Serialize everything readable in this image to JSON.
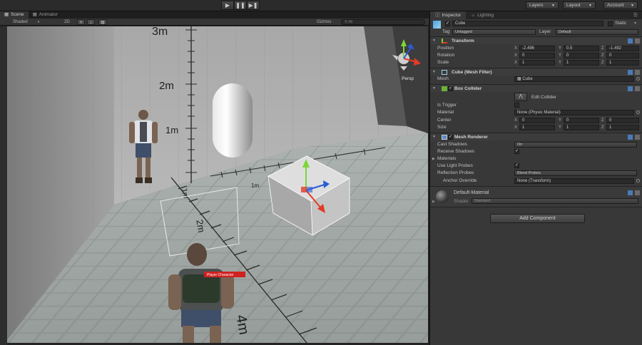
{
  "toolbar": {
    "play_icon": "play-icon",
    "pause_icon": "pause-icon",
    "step_icon": "step-icon",
    "layers_label": "Layers",
    "layout_label": "Layout",
    "account_label": "Account"
  },
  "scene": {
    "tabs": [
      {
        "label": "Scene"
      },
      {
        "label": "Animator"
      }
    ],
    "shading_mode": "Shaded",
    "mode_2d": "2D",
    "gizmos_label": "Gizmos",
    "search_placeholder": "All",
    "persp_label": "Persp",
    "ruler_labels": [
      "3m",
      "2m",
      "1m",
      "1m",
      "2m",
      "4m"
    ],
    "name_tag": "Player Character"
  },
  "inspector": {
    "tabs": [
      {
        "label": "Inspector"
      },
      {
        "label": "Lighting"
      }
    ],
    "object_name": "Cube",
    "static_label": "Static",
    "tag_label": "Tag",
    "tag_value": "Untagged",
    "layer_label": "Layer",
    "layer_value": "Default",
    "transform": {
      "title": "Transform",
      "position_label": "Position",
      "rotation_label": "Rotation",
      "scale_label": "Scale",
      "position": {
        "x": "-2.496",
        "y": "0.5",
        "z": "-1.492"
      },
      "rotation": {
        "x": "0",
        "y": "0",
        "z": "0"
      },
      "scale": {
        "x": "1",
        "y": "1",
        "z": "1"
      }
    },
    "mesh_filter": {
      "title": "Cube (Mesh Filter)",
      "mesh_label": "Mesh",
      "mesh_value": "Cube"
    },
    "box_collider": {
      "title": "Box Collider",
      "edit_collider_label": "Edit Collider",
      "is_trigger_label": "Is Trigger",
      "material_label": "Material",
      "material_value": "None (Physic Material)",
      "center_label": "Center",
      "center": {
        "x": "0",
        "y": "0",
        "z": "0"
      },
      "size_label": "Size",
      "size": {
        "x": "1",
        "y": "1",
        "z": "1"
      }
    },
    "mesh_renderer": {
      "title": "Mesh Renderer",
      "cast_shadows_label": "Cast Shadows",
      "cast_shadows_value": "On",
      "receive_shadows_label": "Receive Shadows",
      "materials_label": "Materials",
      "use_light_probes_label": "Use Light Probes",
      "reflection_probes_label": "Reflection Probes",
      "reflection_probes_value": "Blend Probes",
      "anchor_override_label": "Anchor Override",
      "anchor_override_value": "None (Transform)"
    },
    "material": {
      "name": "Default-Material",
      "shader_label": "Shader",
      "shader_value": "Standard"
    },
    "add_component_label": "Add Component"
  },
  "axis_letters": {
    "x": "X",
    "y": "Y",
    "z": "Z"
  }
}
